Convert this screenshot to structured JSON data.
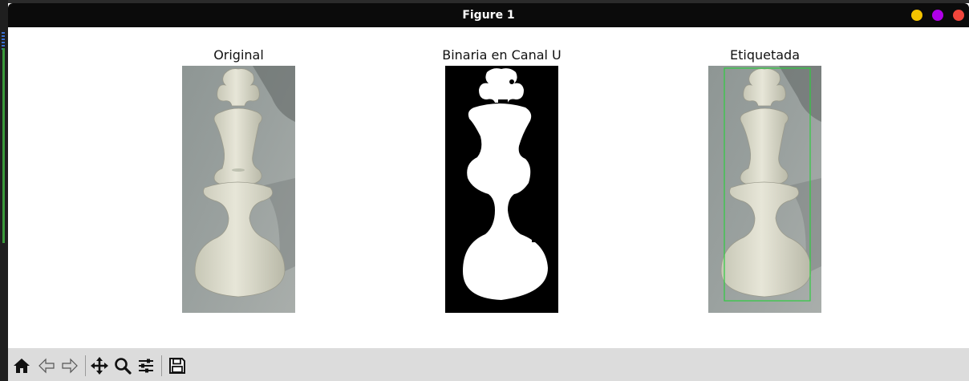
{
  "window": {
    "title": "Figure 1",
    "controls": [
      {
        "name": "minimize-button",
        "color": "#f5c400"
      },
      {
        "name": "maximize-button",
        "color": "#b000e8"
      },
      {
        "name": "close-button",
        "color": "#f0463c"
      }
    ]
  },
  "figure": {
    "panels": [
      {
        "title": "Original"
      },
      {
        "title": "Binaria en Canal U"
      },
      {
        "title": "Etiquetada",
        "bbox_color": "#2ecc40"
      }
    ]
  },
  "toolbar": {
    "buttons": [
      {
        "icon": "home-icon"
      },
      {
        "icon": "back-arrow-icon"
      },
      {
        "icon": "forward-arrow-icon"
      },
      {
        "icon": "move-icon"
      },
      {
        "icon": "zoom-icon"
      },
      {
        "icon": "configure-subplots-icon"
      },
      {
        "icon": "save-icon"
      }
    ]
  }
}
